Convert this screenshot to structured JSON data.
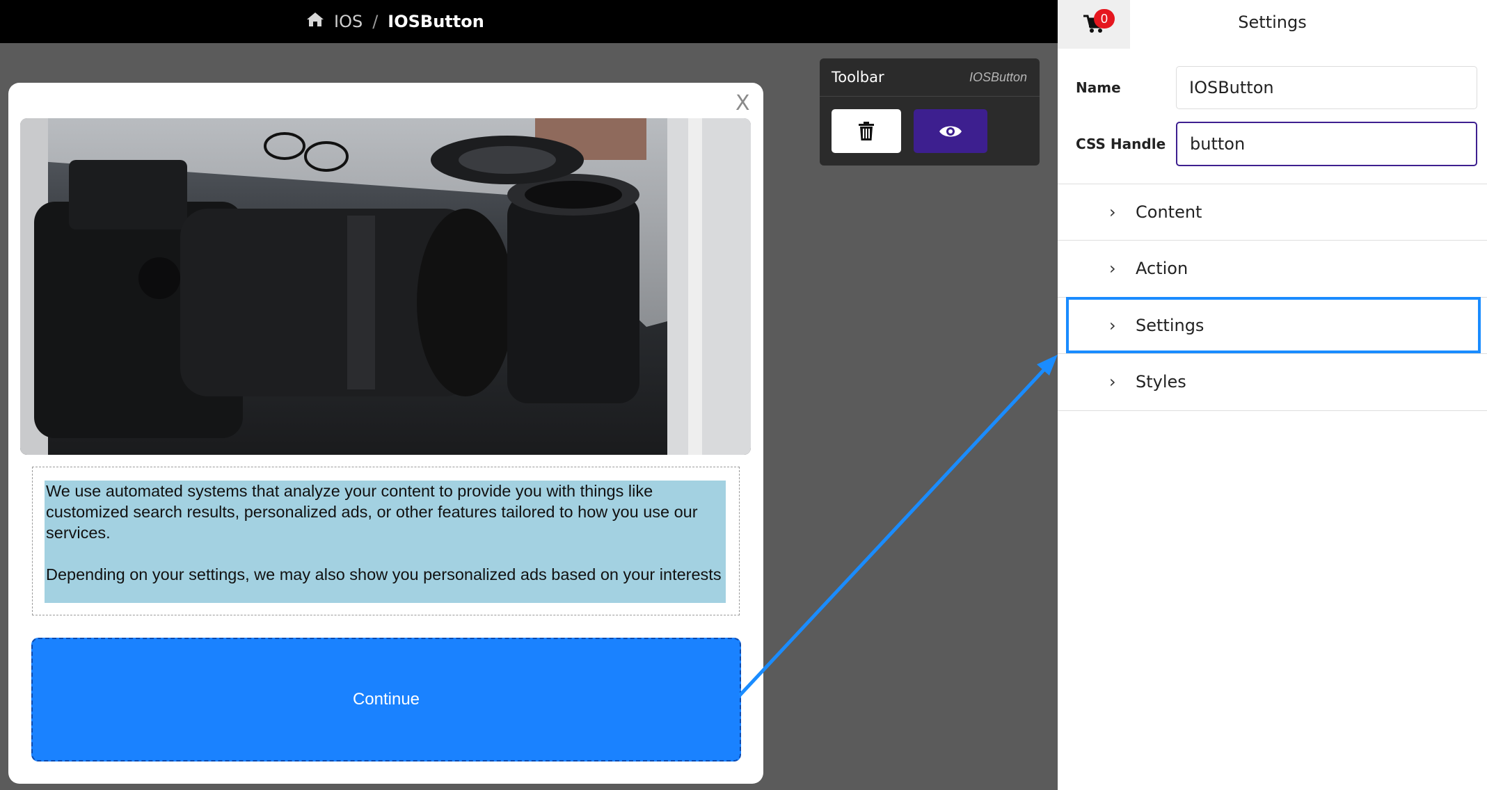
{
  "breadcrumb": {
    "home_icon": "home-icon",
    "parent": "IOS",
    "separator": "/",
    "current": "IOSButton"
  },
  "toolbar": {
    "title": "Toolbar",
    "subtitle": "IOSButton",
    "delete_icon": "trash-icon",
    "preview_icon": "eye-icon"
  },
  "modal": {
    "close_label": "X",
    "paragraph1": "We use automated systems that analyze your content to provide you with things like customized search results, personalized ads, or other features tailored to how you use our services.",
    "paragraph2": "Depending on your settings, we may also show you personalized ads based on your interests",
    "button_label": "Continue"
  },
  "panel": {
    "title": "Settings",
    "cart_count": "0",
    "name_label": "Name",
    "name_value": "IOSButton",
    "css_label": "CSS Handle",
    "css_value": "button",
    "sections": [
      "Content",
      "Action",
      "Settings",
      "Styles"
    ]
  },
  "colors": {
    "accent_purple": "#3d1f8f",
    "cta_blue": "#1a82ff",
    "highlight_blue": "#1a8cff",
    "text_bg": "#a3d1e1"
  }
}
